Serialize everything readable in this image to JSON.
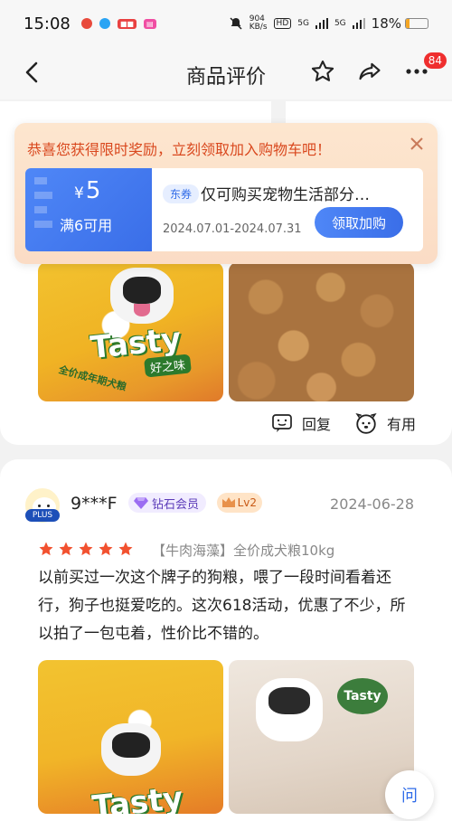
{
  "status_bar": {
    "time": "15:08",
    "net_speed": "904",
    "net_unit": "KB/s",
    "signal1": "5G",
    "signal2": "5G",
    "battery": "18%",
    "battery_level": 0.18,
    "hd_label": "HD"
  },
  "header": {
    "title": "商品评价",
    "badge_count": "84"
  },
  "popup": {
    "message": "恭喜您获得限时奖励，立刻领取加入购物车吧！",
    "coupon": {
      "currency": "¥",
      "amount": "5",
      "condition": "满6可用",
      "tag": "东券",
      "description": "仅可购买宠物生活部分…",
      "date_range": "2024.07.01-2024.07.31",
      "claim_label": "领取加购"
    }
  },
  "review1": {
    "reply_label": "回复",
    "helpful_label": "有用",
    "pack_brand": "Tasty",
    "pack_brand_cn": "好之味",
    "pack_text": "全价成年期犬粮"
  },
  "review2": {
    "plus_label": "PLUS",
    "username": "9***F",
    "member_label": "钻石会员",
    "level_label": "Lv2",
    "date": "2024-06-28",
    "rating": 5,
    "spec": "【牛肉海藻】全价成犬粮10kg",
    "text": "以前买过一次这个牌子的狗粮，喂了一段时间看着还行，狗子也挺爱吃的。这次618活动，优惠了不少，所以拍了一包屯着，性价比不错的。",
    "pack_brand": "Tasty"
  },
  "fab": {
    "label": "问"
  },
  "colors": {
    "accent_blue": "#3a6ee8",
    "star_red": "#f2512f",
    "popup_text": "#d9481e"
  }
}
